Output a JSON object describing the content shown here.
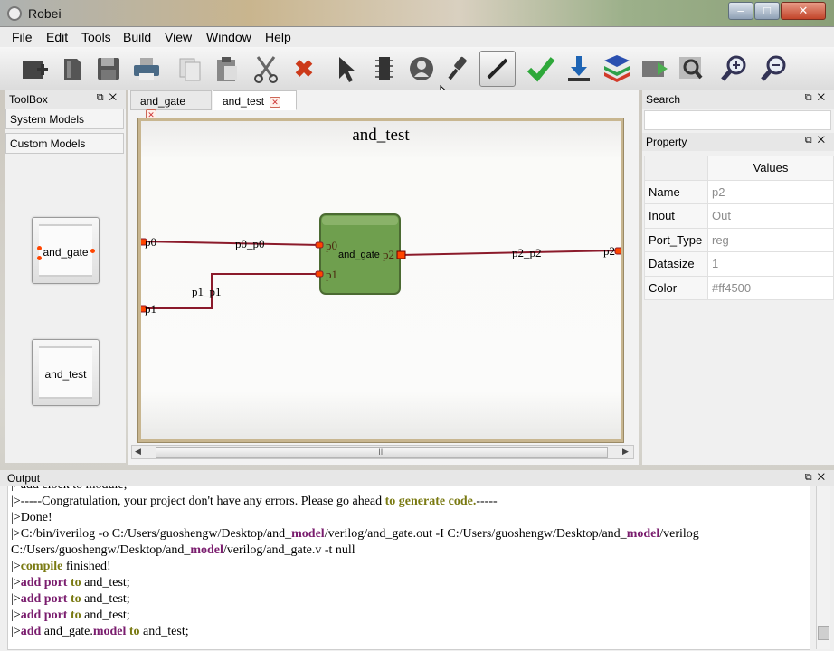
{
  "window": {
    "title": "Robei",
    "min": "–",
    "max": "□",
    "close": "✕"
  },
  "menu": [
    "File",
    "Edit",
    "Tools",
    "Build",
    "View",
    "Window",
    "Help"
  ],
  "toolbar": {
    "icons": [
      "add-module",
      "new-file",
      "save",
      "print",
      "copy",
      "paste",
      "cut",
      "delete",
      "pointer",
      "chip",
      "model",
      "connect",
      "wire",
      "check",
      "download",
      "layers",
      "simulate",
      "zoom-fit",
      "zoom-in",
      "zoom-out"
    ]
  },
  "toolbox": {
    "title": "ToolBox",
    "categories": [
      "System Models",
      "Custom Models"
    ],
    "models": [
      "and_gate",
      "and_test"
    ]
  },
  "editor": {
    "tabs": [
      "and_gate",
      "and_test"
    ],
    "active_tab": "and_test",
    "canvas_title": "and_test",
    "block_label": "and_gate",
    "ports": {
      "p0": "p0",
      "p1": "p1",
      "p2": "p2"
    },
    "wires": {
      "w0": "p0_p0",
      "w1": "p1_p1",
      "w2": "p2_p2"
    },
    "scroll_grip": "III"
  },
  "search": {
    "title": "Search",
    "value": ""
  },
  "property": {
    "title": "Property",
    "column_header": "Values",
    "rows": [
      {
        "key": "Name",
        "value": "p2"
      },
      {
        "key": "Inout",
        "value": "Out"
      },
      {
        "key": "Port_Type",
        "value": "reg"
      },
      {
        "key": "Datasize",
        "value": "1"
      },
      {
        "key": "Color",
        "value": "#ff4500"
      }
    ]
  },
  "output": {
    "title": "Output",
    "lines": {
      "l0": "|>add clock to module;",
      "l1a": "|>-----Congratulation, your project don't have any errors. Please go ahead ",
      "l1b": "to generate code.",
      "l1c": "-----",
      "l2": "|>Done!",
      "l3a": "|>C:/bin/iverilog -o C:/Users/guoshengw/Desktop/and_",
      "l3b": "model",
      "l3c": "/verilog/and_gate.out -I C:/Users/guoshengw/Desktop/and_",
      "l3d": "model",
      "l3e": "/verilog",
      "l4a": "C:/Users/guoshengw/Desktop/and_",
      "l4b": "model",
      "l4c": "/verilog/and_gate.v -t null",
      "l5a": "|>",
      "l5b": "compile",
      "l5c": " finished!",
      "add": "add",
      "port": "port",
      "to": "to",
      "and_test": " and_test;",
      "l9mid": " and_gate.",
      "model": "model"
    }
  },
  "colors": {
    "wire": "#8b1a2b",
    "port": "#ff4500",
    "block": "#6f9f4e",
    "frame": "#c8b690"
  }
}
